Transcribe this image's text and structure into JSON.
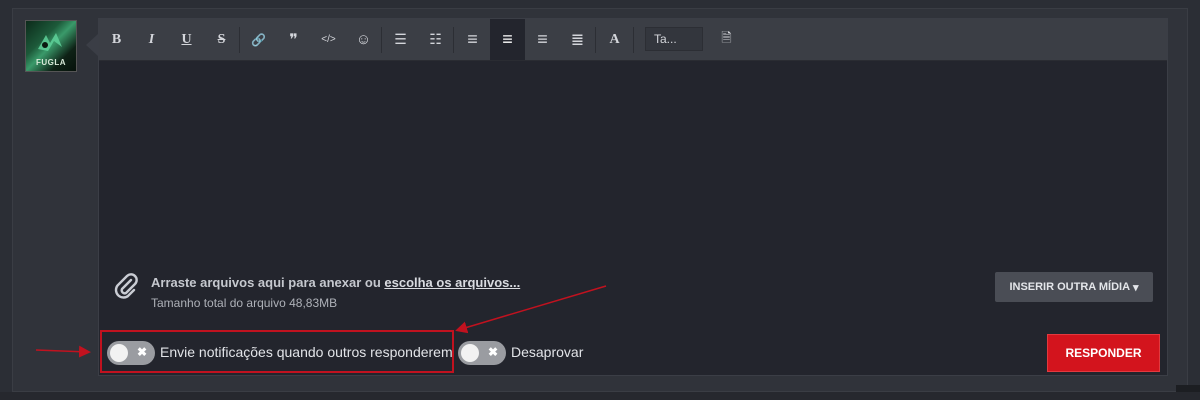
{
  "avatar": {
    "tag": "FUGLA"
  },
  "toolbar": {
    "buttons": [
      {
        "icon": "bold-icon",
        "glyph": "B"
      },
      {
        "icon": "italic-icon",
        "glyph": "I"
      },
      {
        "icon": "underline-icon",
        "glyph": "U"
      },
      {
        "icon": "strikethrough-icon",
        "glyph": "S"
      },
      {
        "icon": "link-icon",
        "glyph": "🔗"
      },
      {
        "icon": "quote-icon",
        "glyph": "❞"
      },
      {
        "icon": "code-icon",
        "glyph": "</>"
      },
      {
        "icon": "smiley-icon",
        "glyph": "☺"
      },
      {
        "icon": "bullet-list-icon",
        "glyph": "☰"
      },
      {
        "icon": "numbered-list-icon",
        "glyph": "☷"
      },
      {
        "icon": "align-center-icon",
        "glyph": "≡"
      },
      {
        "icon": "align-left-icon",
        "glyph": "≡"
      },
      {
        "icon": "align-right-icon",
        "glyph": "≡"
      },
      {
        "icon": "align-justify-icon",
        "glyph": "≣"
      },
      {
        "icon": "font-color-icon",
        "glyph": "A"
      },
      {
        "icon": "template-icon",
        "glyph": "🗎"
      }
    ],
    "size_select": "Ta..."
  },
  "attach": {
    "prefix": "Arraste arquivos aqui para anexar ou ",
    "link": "escolha os arquivos...",
    "size_label": "Tamanho total do arquivo ",
    "size_value": "48,83MB"
  },
  "insert_media": {
    "label": "INSERIR OUTRA MÍDIA",
    "caret": "▾"
  },
  "notify_toggle": {
    "label": "Envie notificações quando outros responderem",
    "state": "off"
  },
  "disapprove_toggle": {
    "label": "Desaprovar",
    "state": "off"
  },
  "respond_button": {
    "label": "RESPONDER"
  },
  "colors": {
    "accent_red": "#d3141d",
    "highlight_border": "#c1121f"
  }
}
